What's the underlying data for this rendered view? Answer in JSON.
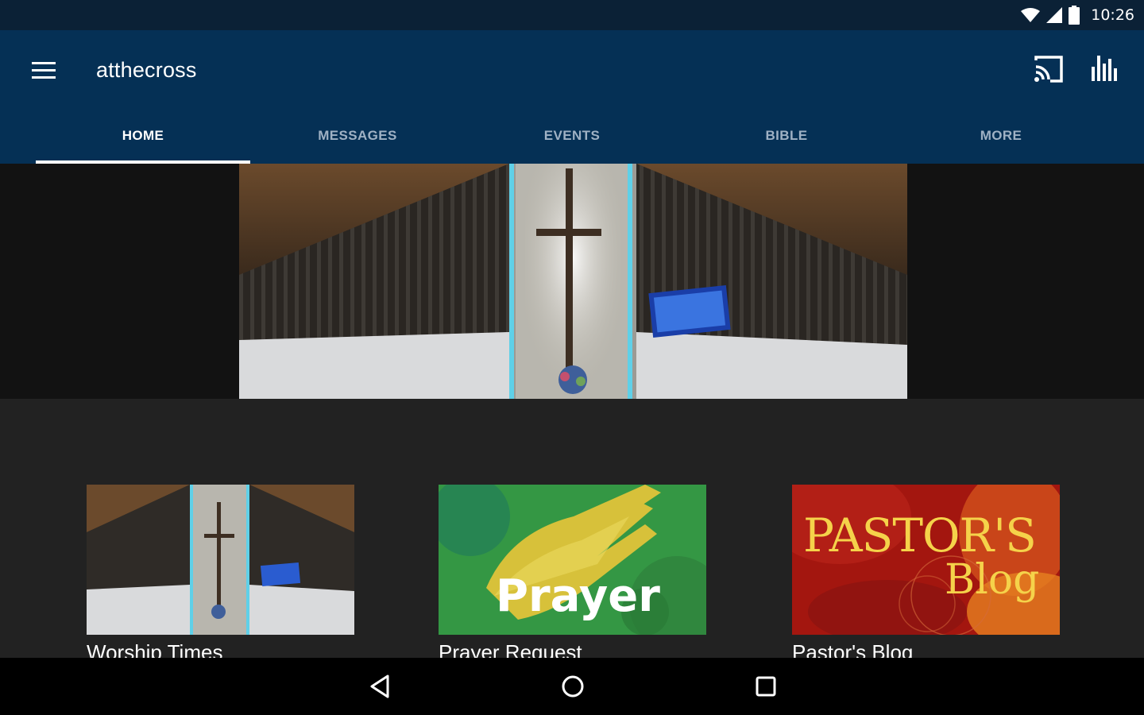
{
  "status_bar": {
    "time": "10:26"
  },
  "app_bar": {
    "title": "atthecross",
    "tabs": [
      {
        "label": "HOME",
        "active": true
      },
      {
        "label": "MESSAGES",
        "active": false
      },
      {
        "label": "EVENTS",
        "active": false
      },
      {
        "label": "BIBLE",
        "active": false
      },
      {
        "label": "MORE",
        "active": false
      }
    ]
  },
  "cards": [
    {
      "label": "Worship Times"
    },
    {
      "label": "Prayer Request",
      "image_text": "Prayer"
    },
    {
      "label": "Pastor's Blog",
      "image_text_line1": "PASTOR'S",
      "image_text_line2": "Blog"
    }
  ],
  "colors": {
    "status_bar": "#0b2136",
    "app_bar": "#053055",
    "tab_inactive": "#9fb1c4",
    "background": "#222222",
    "nav_bar": "#000000"
  },
  "icons": [
    "wifi-icon",
    "cell-signal-icon",
    "battery-icon",
    "menu-icon",
    "cast-icon",
    "stats-icon",
    "back-icon",
    "home-icon",
    "recents-icon"
  ]
}
